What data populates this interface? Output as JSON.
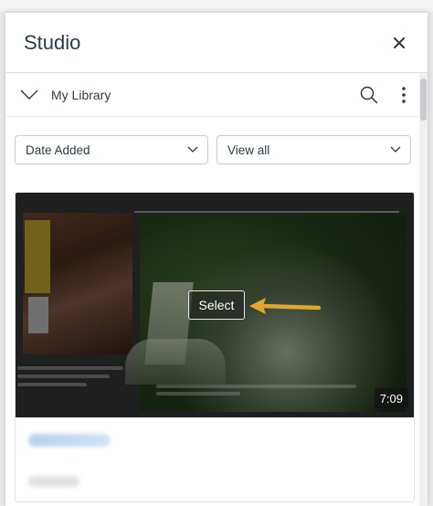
{
  "panel": {
    "title": "Studio",
    "close_icon": "close-icon"
  },
  "library": {
    "label": "My Library",
    "expand_icon": "chevron-down-icon",
    "search_icon": "search-icon",
    "more_icon": "vertical-ellipsis-icon"
  },
  "filters": {
    "sort": {
      "value": "Date Added"
    },
    "view": {
      "value": "View all"
    }
  },
  "media_card": {
    "select_label": "Select",
    "duration": "7:09",
    "arrow_color": "#e0a82e"
  },
  "colors": {
    "text": "#2d3b45",
    "border": "#c7cdd1",
    "background": "#ffffff"
  }
}
